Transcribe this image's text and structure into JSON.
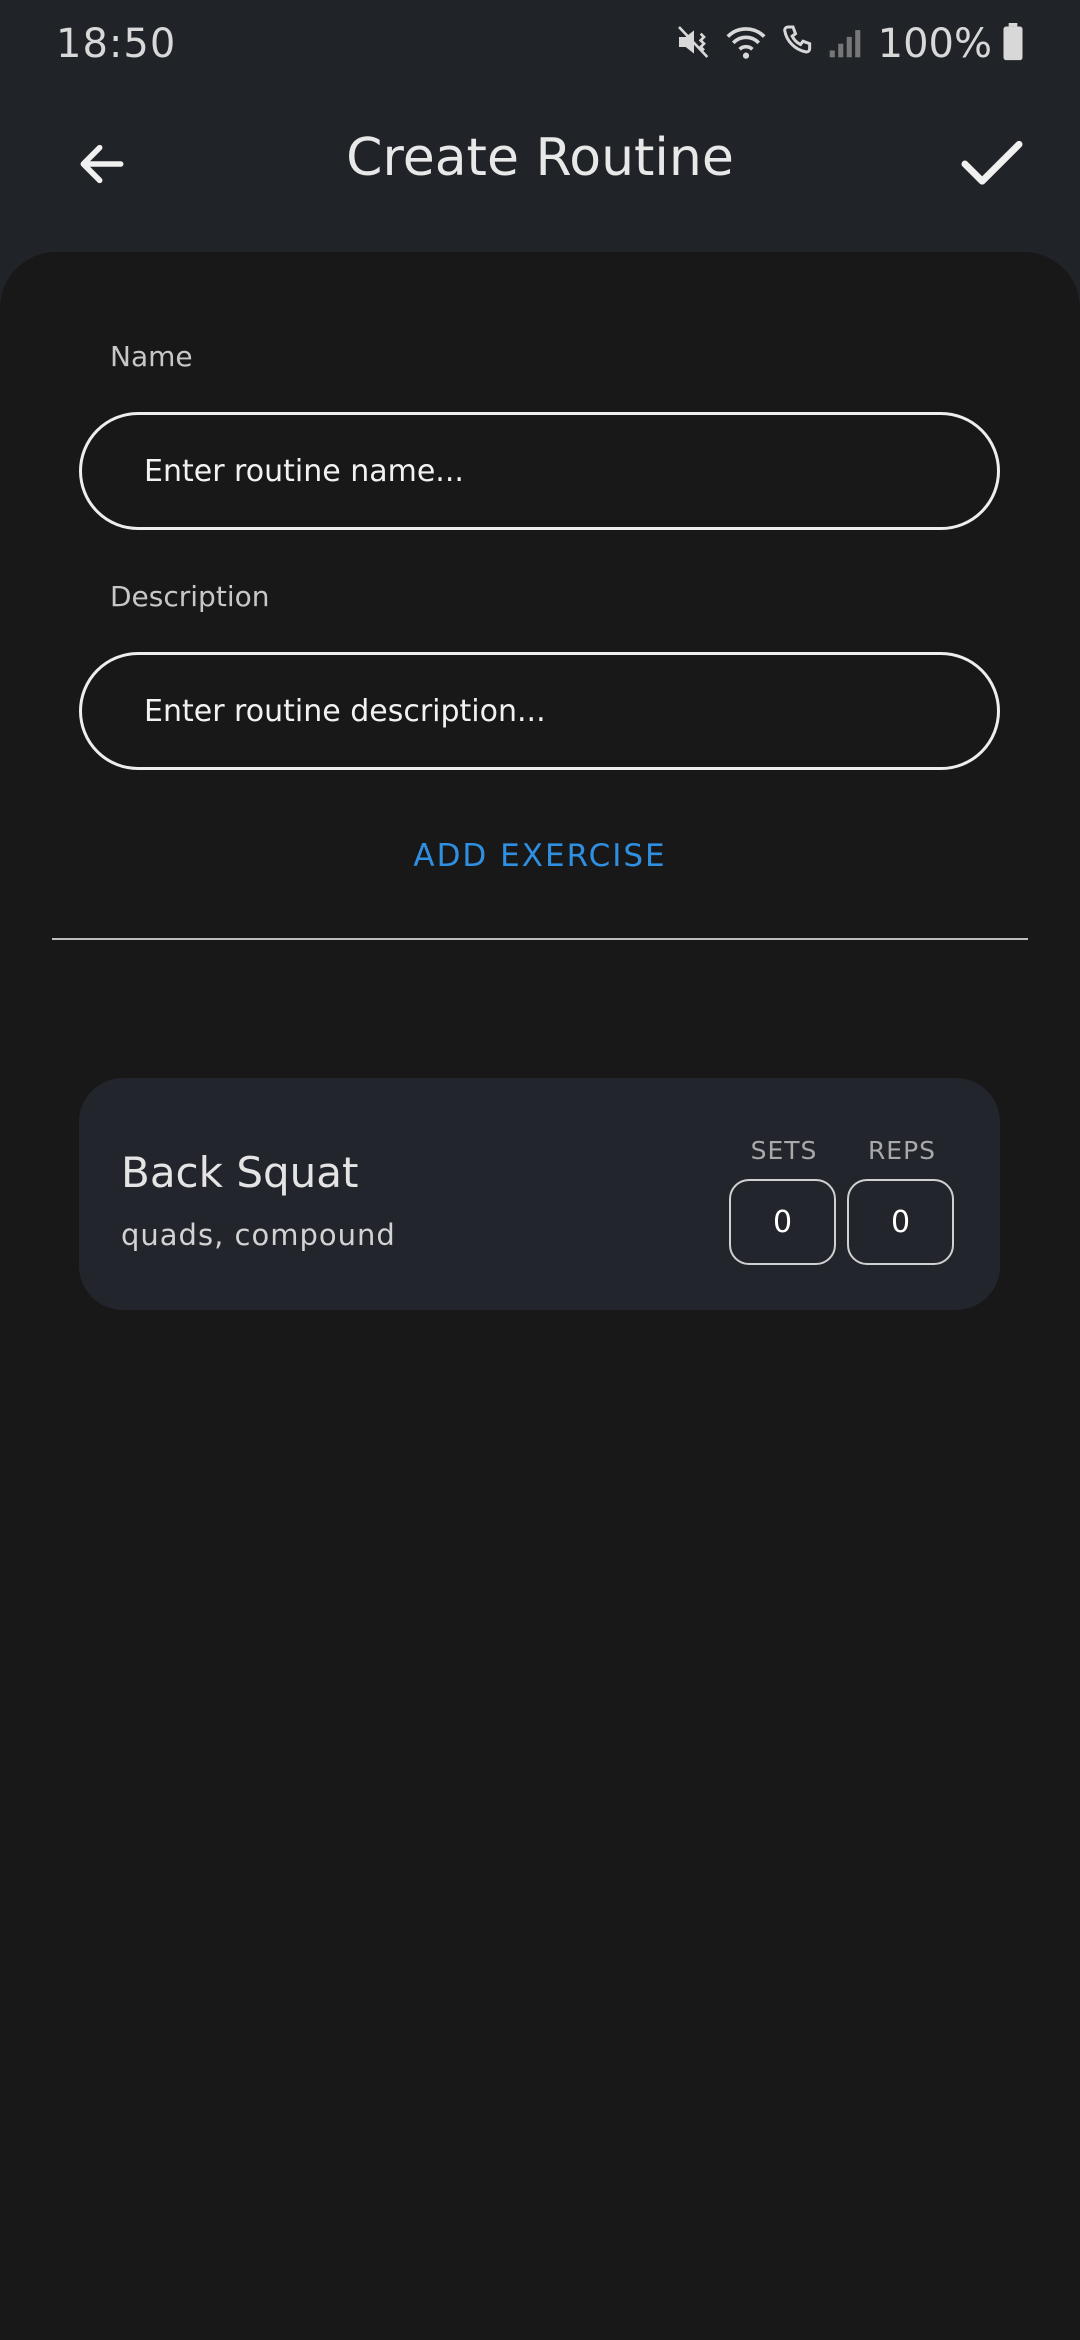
{
  "status_bar": {
    "time": "18:50",
    "battery": "100%",
    "icons": [
      "mute-icon",
      "wifi-icon",
      "call-icon",
      "signal-icon",
      "battery-icon"
    ]
  },
  "app_bar": {
    "title": "Create Routine",
    "back_icon": "arrow-left-icon",
    "confirm_icon": "check-icon"
  },
  "form": {
    "name": {
      "label": "Name",
      "placeholder": "Enter routine name...",
      "value": ""
    },
    "description": {
      "label": "Description",
      "placeholder": "Enter routine description...",
      "value": ""
    },
    "add_exercise_label": "ADD EXERCISE"
  },
  "exercises": [
    {
      "name": "Back Squat",
      "tags": "quads, compound",
      "sets_label": "SETS",
      "reps_label": "REPS",
      "sets": "0",
      "reps": "0"
    }
  ],
  "colors": {
    "background": "#181818",
    "header": "#202328",
    "card": "#22252b",
    "accent": "#2f8fe0"
  }
}
